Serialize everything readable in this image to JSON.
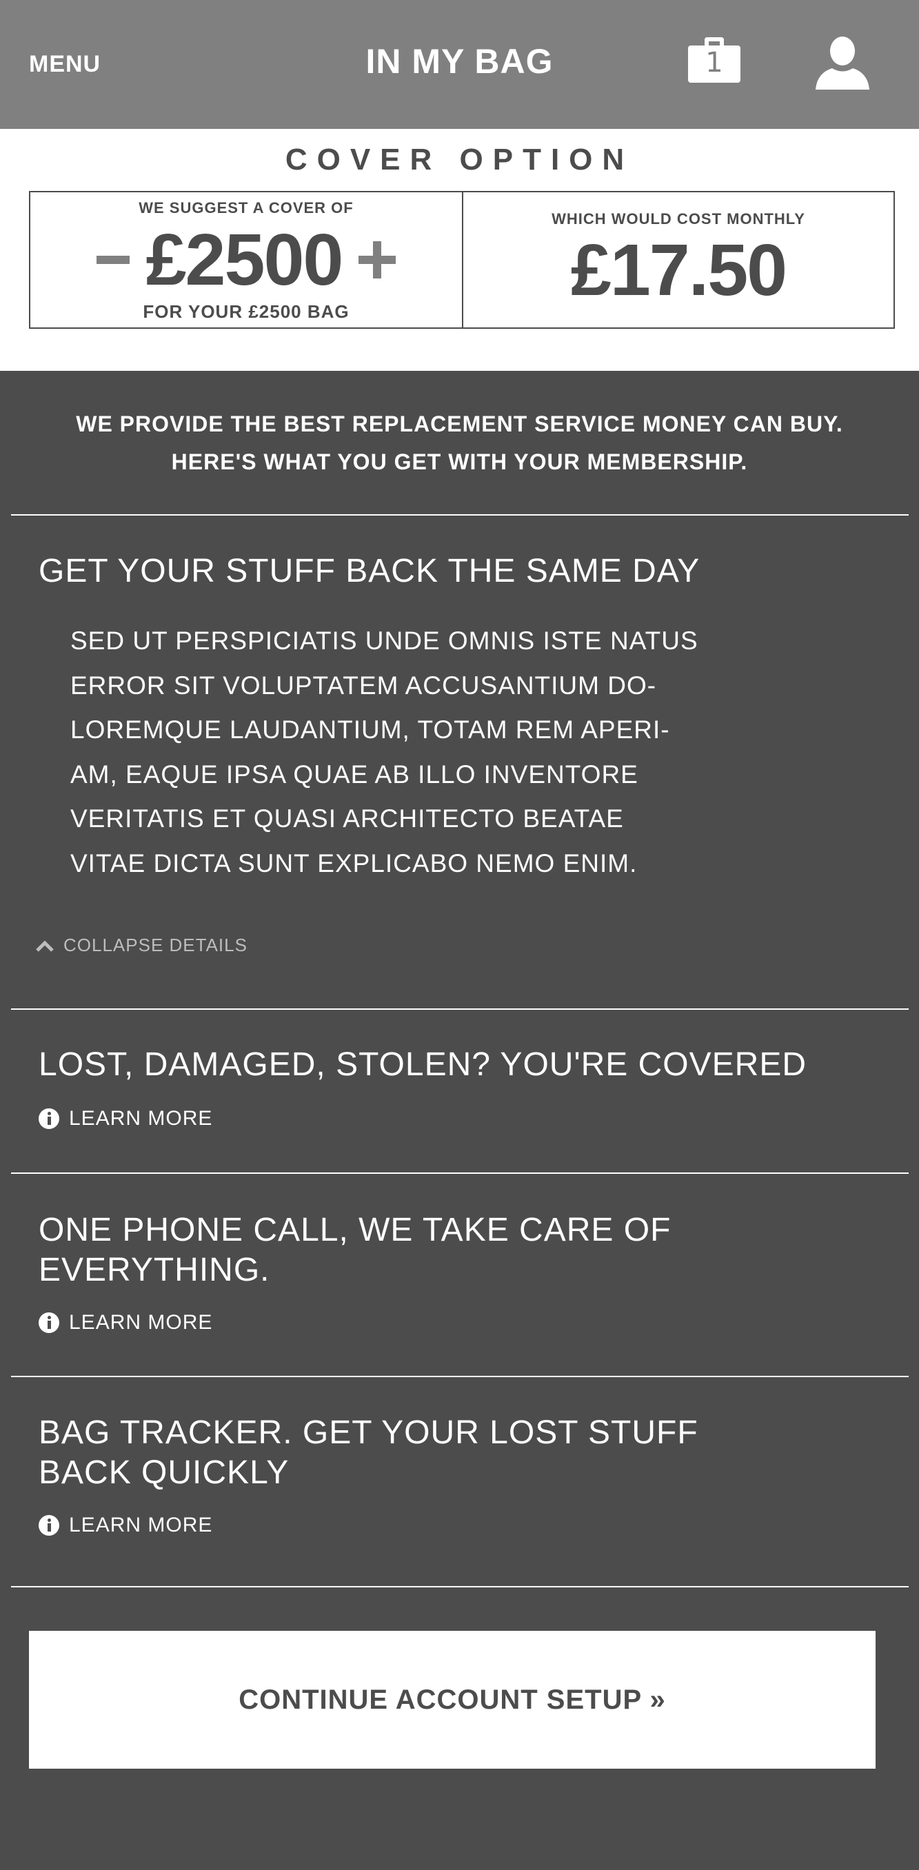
{
  "header": {
    "menu_label": "MENU",
    "title": "IN MY BAG",
    "bag_count": "1",
    "bag_icon": "bag-icon",
    "user_icon": "user-icon"
  },
  "cover": {
    "heading": "COVER OPTION",
    "suggest_label": "WE SUGGEST A COVER OF",
    "amount": "£2500",
    "bag_value_label": "FOR YOUR £2500 BAG",
    "monthly_label": "WHICH WOULD COST MONTHLY",
    "monthly_cost": "£17.50"
  },
  "intro": {
    "line1": "WE PROVIDE THE BEST REPLACEMENT SERVICE MONEY CAN BUY.",
    "line2": "HERE'S WHAT YOU GET WITH YOUR MEMBERSHIP."
  },
  "benefits": [
    {
      "title": "GET YOUR STUFF BACK THE SAME DAY",
      "body_lines": [
        "SED UT PERSPICIATIS UNDE OMNIS ISTE NATUS",
        "ERROR SIT VOLUPTATEM ACCUSANTIUM DO-",
        "LOREMQUE LAUDANTIUM, TOTAM REM APERI-",
        "AM, EAQUE IPSA QUAE AB ILLO INVENTORE",
        "VERITATIS ET QUASI ARCHITECTO BEATAE",
        "VITAE DICTA SUNT EXPLICABO NEMO ENIM."
      ],
      "toggle_label": "COLLAPSE DETAILS"
    },
    {
      "title": "LOST, DAMAGED, STOLEN? YOU'RE COVERED",
      "link_label": "LEARN MORE"
    },
    {
      "title_lines": [
        "ONE PHONE CALL, WE TAKE CARE OF",
        "EVERYTHING."
      ],
      "link_label": "LEARN MORE"
    },
    {
      "title_lines": [
        "BAG TRACKER. GET YOUR LOST STUFF",
        "BACK QUICKLY"
      ],
      "link_label": "LEARN MORE"
    }
  ],
  "cta": {
    "label": "CONTINUE ACCOUNT SETUP »"
  }
}
